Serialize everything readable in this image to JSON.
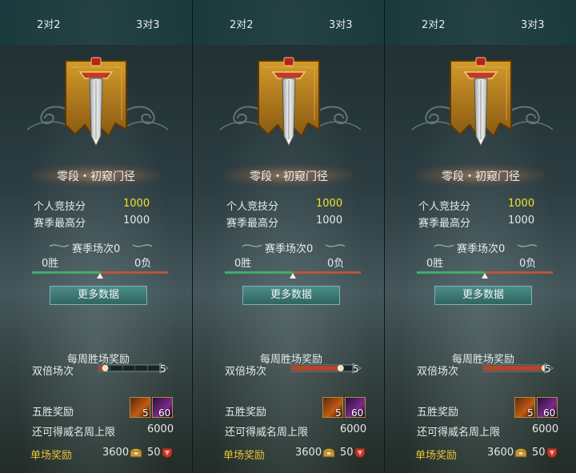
{
  "panels": [
    {
      "modes": [
        "2对2",
        "3对3"
      ],
      "rank_name": "零段・初窥门径",
      "personal_score_label": "个人竞技分",
      "personal_score": "1000",
      "season_high_label": "赛季最高分",
      "season_high": "1000",
      "season_matches": "赛季场次0",
      "wins": "0胜",
      "losses": "0负",
      "more_data": "更多数据",
      "weekly_title": "每周胜场奖励",
      "double_label": "双倍场次",
      "double_count": "5",
      "double_progress": 0.1,
      "five_win_label": "五胜奖励",
      "reward_item_1": "5",
      "reward_item_2": "60",
      "weekly_cap_label": "还可得威名周上限",
      "weekly_cap": "6000",
      "single_label": "单场奖励",
      "single_coin": "3600",
      "single_honor": "50"
    },
    {
      "modes": [
        "2对2",
        "3对3"
      ],
      "rank_name": "零段・初窥门径",
      "personal_score_label": "个人竞技分",
      "personal_score": "1000",
      "season_high_label": "赛季最高分",
      "season_high": "1000",
      "season_matches": "赛季场次0",
      "wins": "0胜",
      "losses": "0负",
      "more_data": "更多数据",
      "weekly_title": "每周胜场奖励",
      "double_label": "双倍场次",
      "double_count": "5",
      "double_progress": 0.8,
      "five_win_label": "五胜奖励",
      "reward_item_1": "5",
      "reward_item_2": "60",
      "weekly_cap_label": "还可得威名周上限",
      "weekly_cap": "6000",
      "single_label": "单场奖励",
      "single_coin": "3600",
      "single_honor": "50"
    },
    {
      "modes": [
        "2对2",
        "3对3"
      ],
      "rank_name": "零段・初窥门径",
      "personal_score_label": "个人竞技分",
      "personal_score": "1000",
      "season_high_label": "赛季最高分",
      "season_high": "1000",
      "season_matches": "赛季场次0",
      "wins": "0胜",
      "losses": "0负",
      "more_data": "更多数据",
      "weekly_title": "每周胜场奖励",
      "double_label": "双倍场次",
      "double_count": "5",
      "double_progress": 1.0,
      "five_win_label": "五胜奖励",
      "reward_item_1": "5",
      "reward_item_2": "60",
      "weekly_cap_label": "还可得威名周上限",
      "weekly_cap": "6000",
      "single_label": "单场奖励",
      "single_coin": "3600",
      "single_honor": "50"
    }
  ],
  "colors": {
    "score_highlight": "#f4e12d",
    "single_reward_label": "#e9c237",
    "win_bar": "#3fae6a",
    "loss_bar": "#b5573a",
    "button": "#3f7a76"
  }
}
